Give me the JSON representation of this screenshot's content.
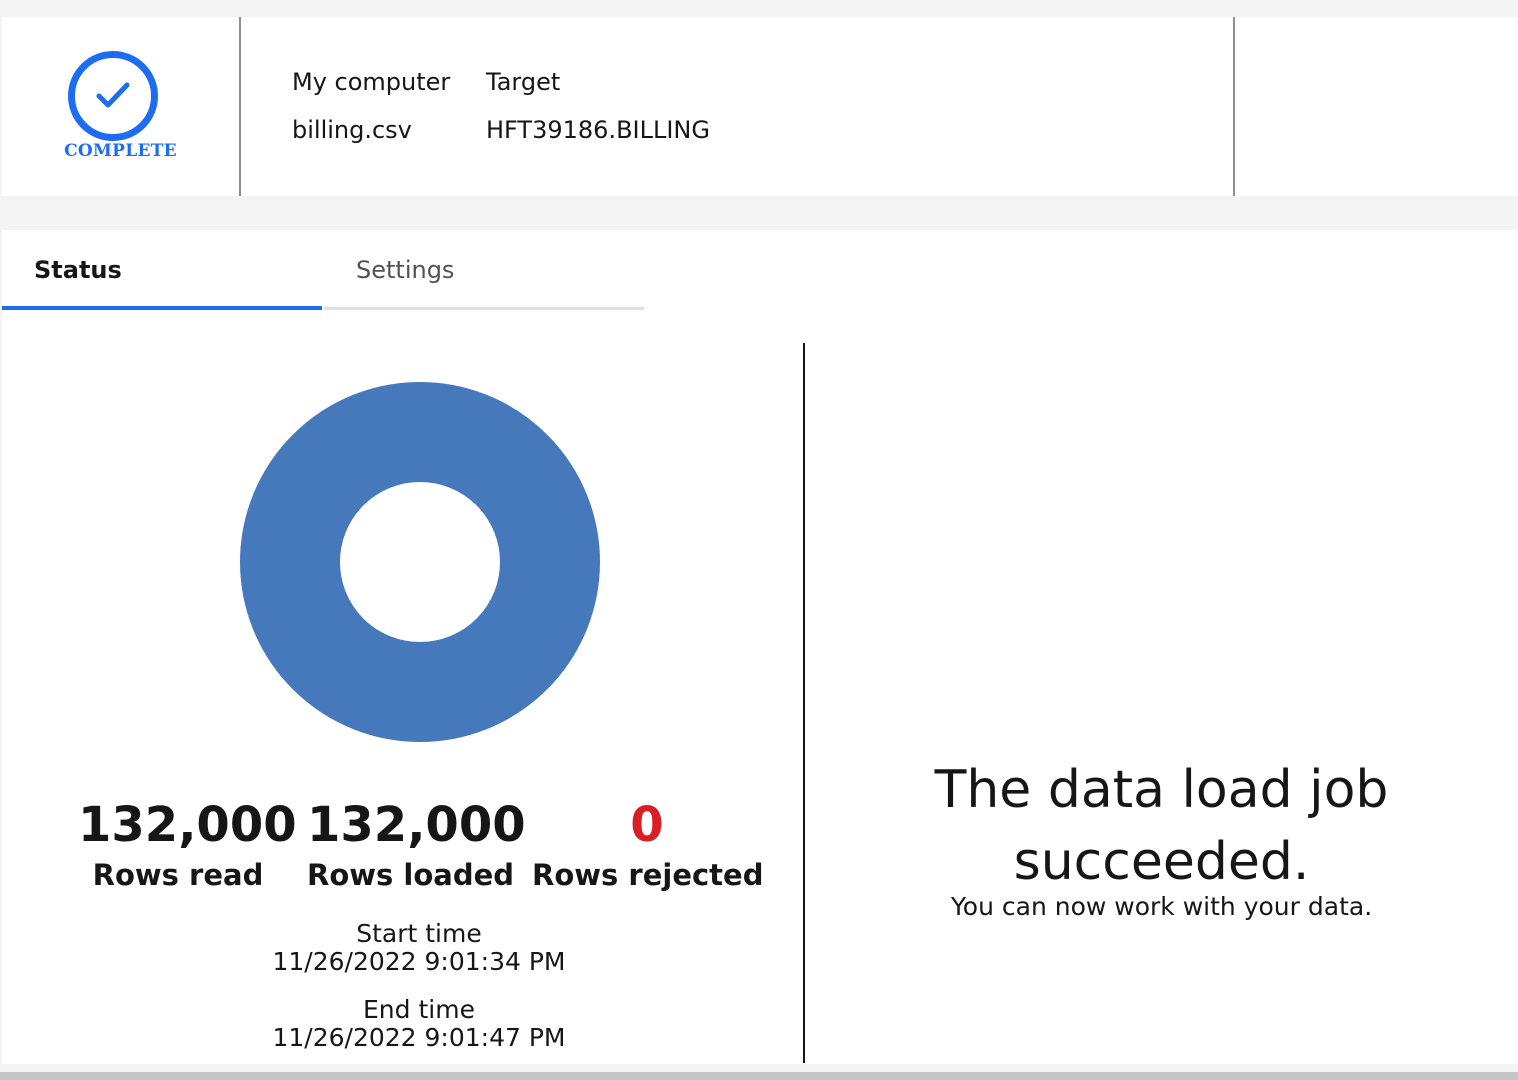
{
  "header": {
    "status_label": "COMPLETE",
    "source_heading": "My computer",
    "source_value": "billing.csv",
    "target_heading": "Target",
    "target_value": "HFT39186.BILLING"
  },
  "tabs": [
    {
      "label": "Status",
      "selected": true
    },
    {
      "label": "Settings",
      "selected": false
    }
  ],
  "stats": {
    "rows_read": {
      "value": "132,000",
      "label": "Rows read"
    },
    "rows_loaded": {
      "value": "132,000",
      "label": "Rows loaded"
    },
    "rows_rejected": {
      "value": "0",
      "label": "Rows rejected"
    }
  },
  "times": {
    "start_label": "Start time",
    "start_value": "11/26/2022 9:01:34 PM",
    "end_label": "End time",
    "end_value": "11/26/2022 9:01:47 PM"
  },
  "result": {
    "headline": "The data load job succeeded.",
    "subtext": "You can now work with your data."
  },
  "donut": {
    "loaded_fraction": 1.0,
    "color": "#4679bb"
  },
  "colors": {
    "accent": "#1d6df2",
    "rejected": "#da1e28"
  }
}
